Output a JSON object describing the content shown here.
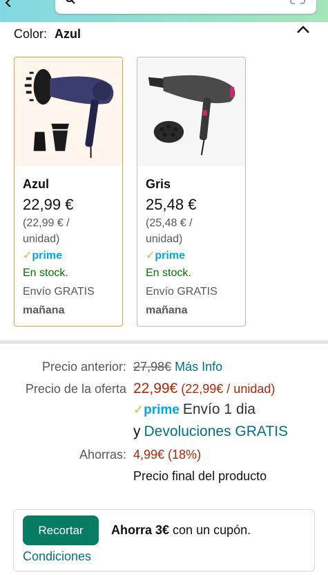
{
  "color_selector": {
    "label": "Color:",
    "selected_value": "Azul"
  },
  "swatches": [
    {
      "name": "Azul",
      "price": "22,99 €",
      "unit_price_line1": "(22,99 € /",
      "unit_price_line2": "unidad)",
      "prime_label": "prime",
      "stock": "En stock.",
      "shipping": "Envío GRATIS",
      "delivery": "mañana",
      "selected": true
    },
    {
      "name": "Gris",
      "price": "25,48 €",
      "unit_price_line1": "(25,48 € /",
      "unit_price_line2": "unidad)",
      "prime_label": "prime",
      "stock": "En stock.",
      "shipping": "Envío GRATIS",
      "delivery": "mañana",
      "selected": false
    }
  ],
  "pricing": {
    "previous_label": "Precio anterior:",
    "previous_price": "27,98€",
    "more_info": "Más Info",
    "deal_label": "Precio de la oferta",
    "deal_price": "22,99€",
    "deal_unit": "(22,99€ / unidad)",
    "prime_label": "prime",
    "delivery_text": "Envío 1 dia",
    "returns_prefix": "y",
    "returns_link": "Devoluciones GRATIS",
    "savings_label": "Ahorras:",
    "savings_value": "4,99€ (18%)",
    "final_price_note": "Precio final del producto"
  },
  "coupon": {
    "button_label": "Recortar",
    "bold_text": "Ahorra 3€",
    "rest_text": " con un cupón.",
    "conditions_link": "Condiciones"
  },
  "icons": {
    "back": "arrow-left-icon",
    "search": "search-icon",
    "scan": "scan-icon",
    "collapse": "chevron-up-icon",
    "prime_check": "checkmark-icon"
  },
  "colors": {
    "header_gradient_start": "#82d8e3",
    "header_gradient_end": "#a5e6ba",
    "selected_border": "#e3a344",
    "price_red": "#b12704",
    "link": "#007185",
    "stock_green": "#007600",
    "prime_blue": "#00a8e1",
    "clip_button": "#067d62"
  }
}
